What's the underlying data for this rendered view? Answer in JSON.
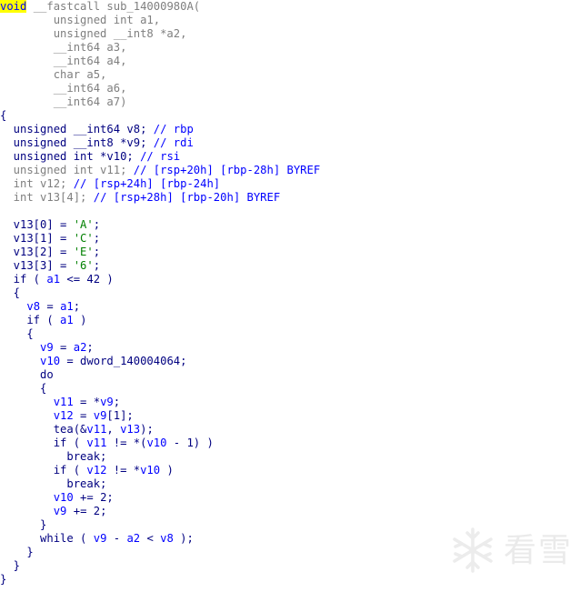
{
  "code": {
    "lines": [
      [
        {
          "t": "void",
          "c": "k",
          "hl": true
        },
        {
          "t": " __fastcall sub_14000980A(",
          "c": "c"
        }
      ],
      [
        {
          "t": "        unsigned int a1,",
          "c": "c"
        }
      ],
      [
        {
          "t": "        unsigned __int8 *a2,",
          "c": "c"
        }
      ],
      [
        {
          "t": "        __int64 a3,",
          "c": "c"
        }
      ],
      [
        {
          "t": "        __int64 a4,",
          "c": "c"
        }
      ],
      [
        {
          "t": "        char a5,",
          "c": "c"
        }
      ],
      [
        {
          "t": "        __int64 a6,",
          "c": "c"
        }
      ],
      [
        {
          "t": "        __int64 a7)",
          "c": "c"
        }
      ],
      [
        {
          "t": "{",
          "c": "b"
        }
      ],
      [
        {
          "t": "  unsigned __int64 v8; ",
          "c": "b"
        },
        {
          "t": "// rbp",
          "c": "k"
        }
      ],
      [
        {
          "t": "  unsigned __int8 *v9; ",
          "c": "b"
        },
        {
          "t": "// rdi",
          "c": "k"
        }
      ],
      [
        {
          "t": "  unsigned int *v10; ",
          "c": "b"
        },
        {
          "t": "// rsi",
          "c": "k"
        }
      ],
      [
        {
          "t": "  unsigned int v11; ",
          "c": "c"
        },
        {
          "t": "// [rsp+20h] [rbp-28h] BYREF",
          "c": "k"
        }
      ],
      [
        {
          "t": "  int v12; ",
          "c": "c"
        },
        {
          "t": "// [rsp+24h] [rbp-24h]",
          "c": "k"
        }
      ],
      [
        {
          "t": "  int v13[4]; ",
          "c": "c"
        },
        {
          "t": "// [rsp+28h] [rbp-20h] BYREF",
          "c": "k"
        }
      ],
      [
        {
          "t": "",
          "c": "c"
        }
      ],
      [
        {
          "t": "  v13[0] = ",
          "c": "b"
        },
        {
          "t": "'A'",
          "c": "n"
        },
        {
          "t": ";",
          "c": "b"
        }
      ],
      [
        {
          "t": "  v13[1] = ",
          "c": "b"
        },
        {
          "t": "'C'",
          "c": "n"
        },
        {
          "t": ";",
          "c": "b"
        }
      ],
      [
        {
          "t": "  v13[2] = ",
          "c": "b"
        },
        {
          "t": "'E'",
          "c": "n"
        },
        {
          "t": ";",
          "c": "b"
        }
      ],
      [
        {
          "t": "  v13[3] = ",
          "c": "b"
        },
        {
          "t": "'6'",
          "c": "n"
        },
        {
          "t": ";",
          "c": "b"
        }
      ],
      [
        {
          "t": "  if ( ",
          "c": "b"
        },
        {
          "t": "a1",
          "c": "k"
        },
        {
          "t": " <= 42 )",
          "c": "b"
        }
      ],
      [
        {
          "t": "  {",
          "c": "b"
        }
      ],
      [
        {
          "t": "    ",
          "c": "b"
        },
        {
          "t": "v8",
          "c": "k"
        },
        {
          "t": " = ",
          "c": "b"
        },
        {
          "t": "a1",
          "c": "k"
        },
        {
          "t": ";",
          "c": "b"
        }
      ],
      [
        {
          "t": "    if ( ",
          "c": "b"
        },
        {
          "t": "a1",
          "c": "k"
        },
        {
          "t": " )",
          "c": "b"
        }
      ],
      [
        {
          "t": "    {",
          "c": "b"
        }
      ],
      [
        {
          "t": "      ",
          "c": "b"
        },
        {
          "t": "v9",
          "c": "k"
        },
        {
          "t": " = ",
          "c": "b"
        },
        {
          "t": "a2",
          "c": "k"
        },
        {
          "t": ";",
          "c": "b"
        }
      ],
      [
        {
          "t": "      ",
          "c": "b"
        },
        {
          "t": "v10",
          "c": "k"
        },
        {
          "t": " = dword_140004064;",
          "c": "b"
        }
      ],
      [
        {
          "t": "      do",
          "c": "b"
        }
      ],
      [
        {
          "t": "      {",
          "c": "b"
        }
      ],
      [
        {
          "t": "        ",
          "c": "b"
        },
        {
          "t": "v11",
          "c": "k"
        },
        {
          "t": " = *",
          "c": "b"
        },
        {
          "t": "v9",
          "c": "k"
        },
        {
          "t": ";",
          "c": "b"
        }
      ],
      [
        {
          "t": "        ",
          "c": "b"
        },
        {
          "t": "v12",
          "c": "k"
        },
        {
          "t": " = ",
          "c": "b"
        },
        {
          "t": "v9",
          "c": "k"
        },
        {
          "t": "[1];",
          "c": "b"
        }
      ],
      [
        {
          "t": "        tea(&",
          "c": "b"
        },
        {
          "t": "v11",
          "c": "k"
        },
        {
          "t": ", ",
          "c": "b"
        },
        {
          "t": "v13",
          "c": "k"
        },
        {
          "t": ");",
          "c": "b"
        }
      ],
      [
        {
          "t": "        if ( ",
          "c": "b"
        },
        {
          "t": "v11",
          "c": "k"
        },
        {
          "t": " != *(",
          "c": "b"
        },
        {
          "t": "v10",
          "c": "k"
        },
        {
          "t": " - 1) )",
          "c": "b"
        }
      ],
      [
        {
          "t": "          break;",
          "c": "b"
        }
      ],
      [
        {
          "t": "        if ( ",
          "c": "b"
        },
        {
          "t": "v12",
          "c": "k"
        },
        {
          "t": " != *",
          "c": "b"
        },
        {
          "t": "v10",
          "c": "k"
        },
        {
          "t": " )",
          "c": "b"
        }
      ],
      [
        {
          "t": "          break;",
          "c": "b"
        }
      ],
      [
        {
          "t": "        ",
          "c": "b"
        },
        {
          "t": "v10",
          "c": "k"
        },
        {
          "t": " += 2;",
          "c": "b"
        }
      ],
      [
        {
          "t": "        ",
          "c": "b"
        },
        {
          "t": "v9",
          "c": "k"
        },
        {
          "t": " += 2;",
          "c": "b"
        }
      ],
      [
        {
          "t": "      }",
          "c": "b"
        }
      ],
      [
        {
          "t": "      while ( ",
          "c": "b"
        },
        {
          "t": "v9",
          "c": "k"
        },
        {
          "t": " - ",
          "c": "b"
        },
        {
          "t": "a2",
          "c": "k"
        },
        {
          "t": " < ",
          "c": "b"
        },
        {
          "t": "v8",
          "c": "k"
        },
        {
          "t": " );",
          "c": "b"
        }
      ],
      [
        {
          "t": "    }",
          "c": "b"
        }
      ],
      [
        {
          "t": "  }",
          "c": "b"
        }
      ],
      [
        {
          "t": "}",
          "c": "b"
        }
      ]
    ]
  },
  "watermark": {
    "text": "看雪",
    "icon": "snowflake-logo-icon"
  }
}
